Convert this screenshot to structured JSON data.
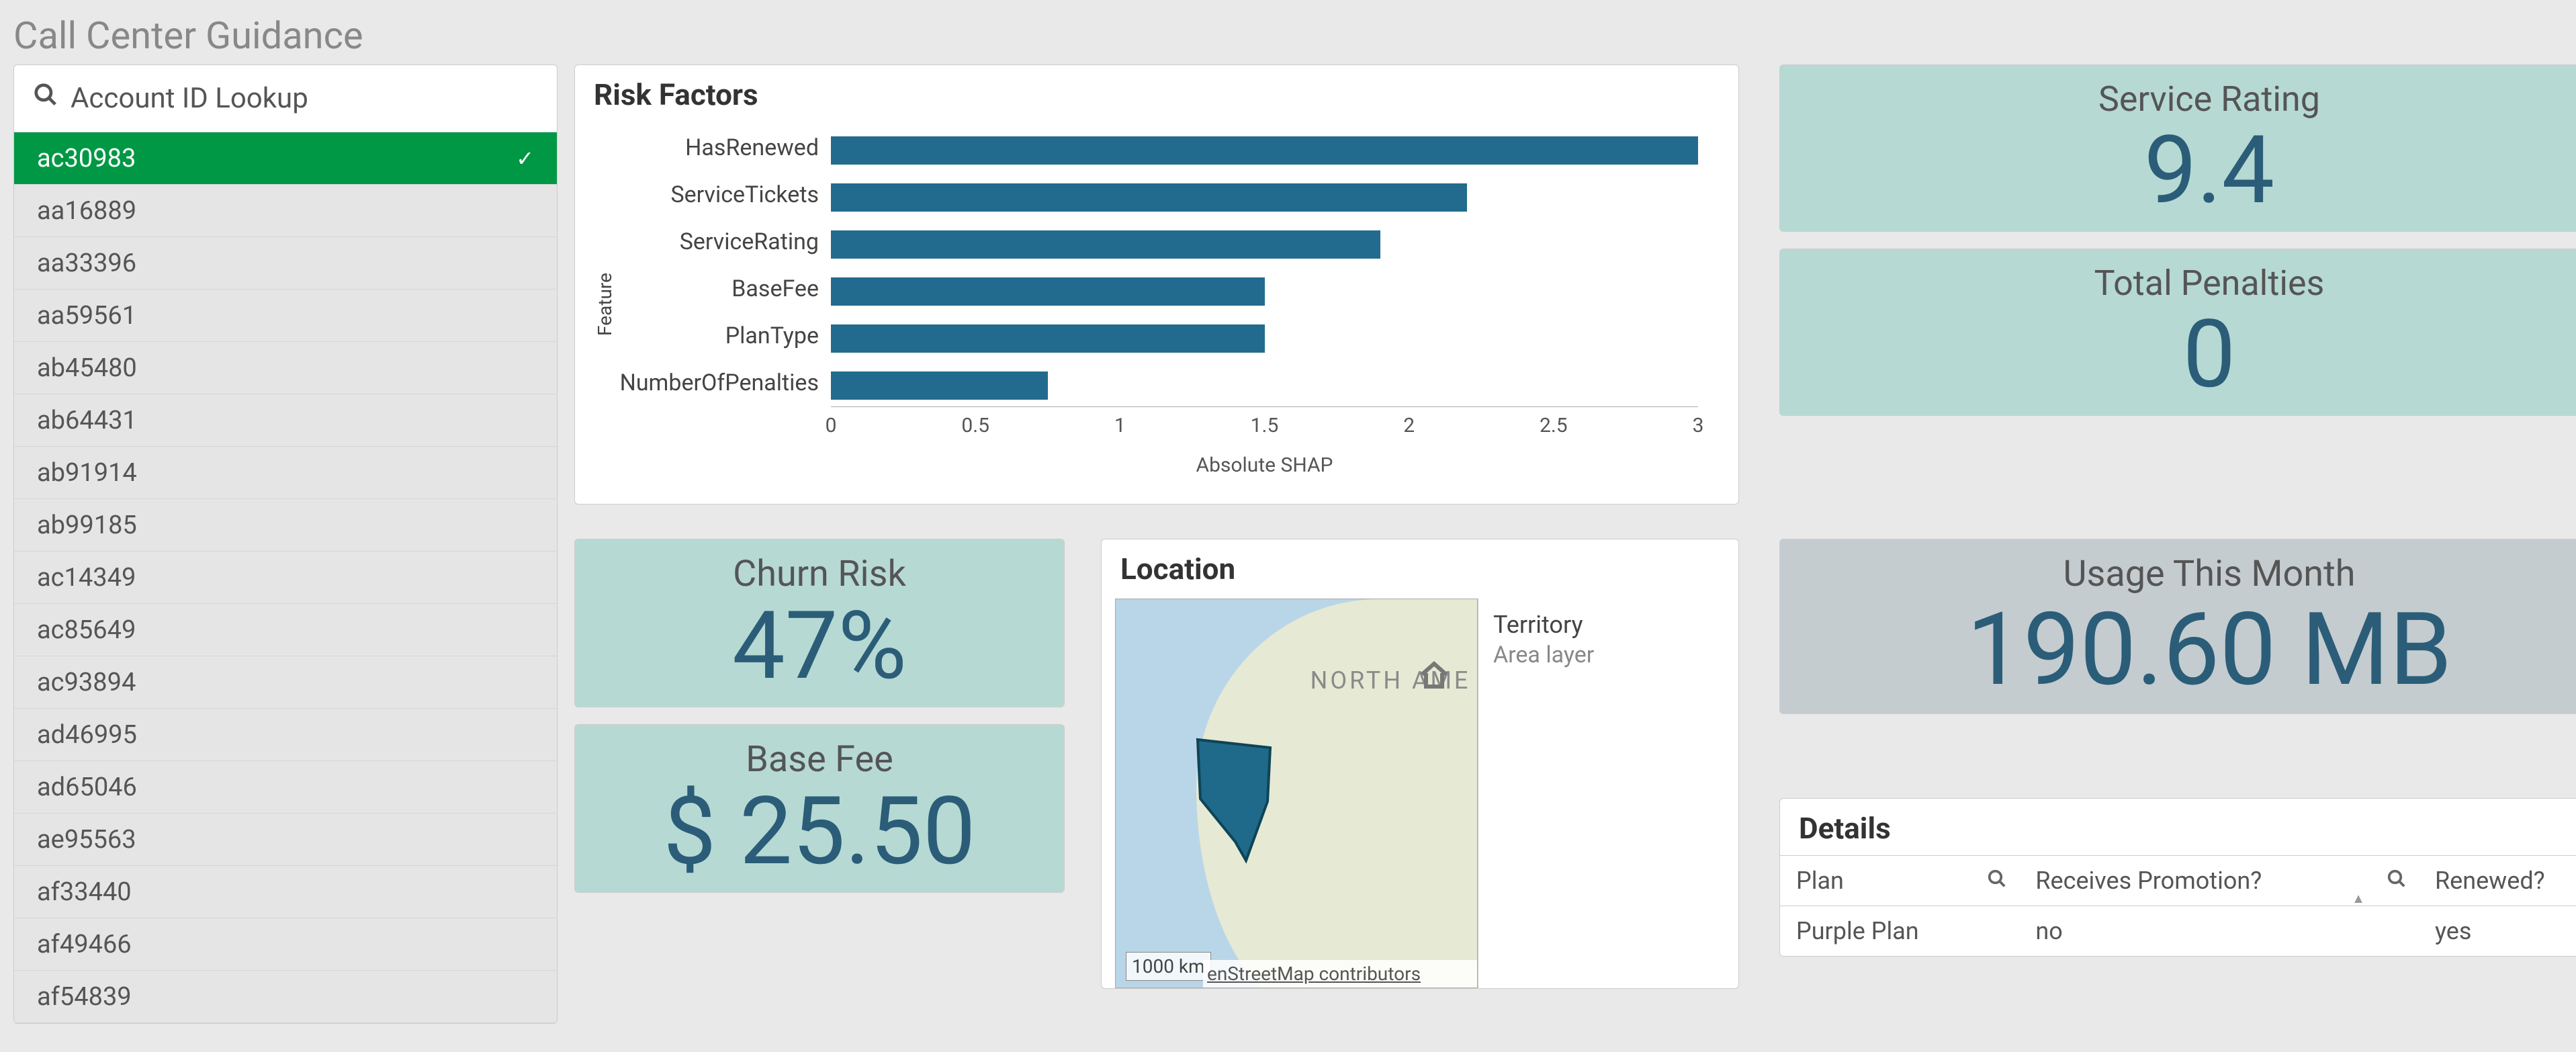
{
  "page_title": "Call Center Guidance",
  "account_lookup": {
    "placeholder": "Account ID Lookup",
    "selected": "ac30983",
    "items": [
      "ac30983",
      "aa16889",
      "aa33396",
      "aa59561",
      "ab45480",
      "ab64431",
      "ab91914",
      "ab99185",
      "ac14349",
      "ac85649",
      "ac93894",
      "ad46995",
      "ad65046",
      "ae95563",
      "af33440",
      "af49466",
      "af54839"
    ]
  },
  "risk_factors": {
    "title": "Risk Factors",
    "ylabel": "Feature",
    "xlabel": "Absolute SHAP"
  },
  "chart_data": {
    "type": "bar",
    "orientation": "horizontal",
    "title": "Risk Factors",
    "ylabel": "Feature",
    "xlabel": "Absolute SHAP",
    "categories": [
      "HasRenewed",
      "ServiceTickets",
      "ServiceRating",
      "BaseFee",
      "PlanType",
      "NumberOfPenalties"
    ],
    "values": [
      3.0,
      2.2,
      1.9,
      1.5,
      1.5,
      0.75
    ],
    "xlim": [
      0,
      3
    ],
    "xticks": [
      0,
      0.5,
      1,
      1.5,
      2,
      2.5,
      3
    ]
  },
  "kpi": {
    "service_rating": {
      "label": "Service Rating",
      "value": "9.4"
    },
    "total_penalties": {
      "label": "Total Penalties",
      "value": "0"
    },
    "churn_risk": {
      "label": "Churn Risk",
      "value": "47%"
    },
    "base_fee": {
      "label": "Base Fee",
      "value": "$ 25.50"
    },
    "usage": {
      "label": "Usage This Month",
      "value": "190.60 MB"
    }
  },
  "location": {
    "title": "Location",
    "banner": "NORTH AME",
    "scale": "1000 km",
    "attribution": "enStreetMap contributors",
    "legend_title": "Territory",
    "legend_sub": "Area layer"
  },
  "details": {
    "title": "Details",
    "columns": [
      "Plan",
      "Receives Promotion?",
      "Renewed?"
    ],
    "row": {
      "plan": "Purple Plan",
      "promo": "no",
      "renewed": "yes"
    }
  }
}
